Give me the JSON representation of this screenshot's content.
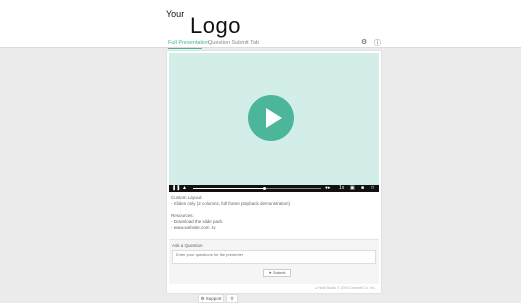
{
  "logo": {
    "small": "Your",
    "big": "Logo"
  },
  "tabs": [
    {
      "label": "Full Presentation",
      "active": true
    },
    {
      "label": "Question Submit Tab",
      "active": false
    }
  ],
  "header_icons": [
    "gear-icon",
    "help-icon"
  ],
  "video": {
    "progress_fraction": 0.56,
    "controls": {
      "speed_label": "1x"
    }
  },
  "content": {
    "layout_title": "Custom Layout:",
    "layout_desc": "- Slides only (2 columns, full frame playback demonstration)",
    "resources_title": "Resources:",
    "resources": [
      "- Download the slide pack",
      "- www.website.com .tv"
    ]
  },
  "ask": {
    "title": "Ask a Question",
    "placeholder": "Enter your questions for the presenter",
    "submit_label": "Submit"
  },
  "footer": {
    "credit": "Host Studio © 2019 Channel Co. Inc."
  },
  "bottom_bar": {
    "support_label": "Support"
  },
  "colors": {
    "accent": "#4ab394",
    "video_bg": "#d3ede8",
    "play_button": "#4cb69a"
  }
}
